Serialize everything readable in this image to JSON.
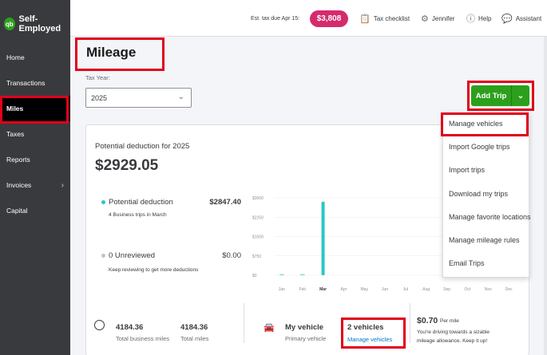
{
  "app": {
    "brand_logo": "qb",
    "brand_name": "Self-Employed"
  },
  "sidebar": {
    "items": [
      {
        "label": "Home"
      },
      {
        "label": "Transactions"
      },
      {
        "label": "Miles"
      },
      {
        "label": "Taxes"
      },
      {
        "label": "Reports"
      },
      {
        "label": "Invoices"
      },
      {
        "label": "Capital"
      }
    ],
    "active": "Miles"
  },
  "topbar": {
    "est_tax_label": "Est. tax due Apr 15:",
    "est_tax_amount": "$3,808",
    "tax_checklist": "Tax checklist",
    "user": "Jennifer",
    "help": "Help",
    "assistant": "Assistant"
  },
  "page": {
    "title": "Mileage",
    "tax_year_label": "Tax Year:",
    "tax_year_value": "2025",
    "add_trip_label": "Add Trip"
  },
  "summary": {
    "potential_deduction_label": "Potential deduction for 2025",
    "potential_deduction_value": "$2929.05",
    "row1_title": "Potential deduction",
    "row1_sub": "4 Business trips in March",
    "row1_amount": "$2847.40",
    "row2_title": "0 Unreviewed",
    "row2_sub": "Keep reviewing to get more deductions",
    "row2_amount": "$0.00"
  },
  "chart_data": {
    "type": "bar",
    "categories": [
      "Jan",
      "Feb",
      "Mar",
      "Apr",
      "May",
      "Jun",
      "Jul",
      "Aug",
      "Sep",
      "Oct",
      "Nov",
      "Dec"
    ],
    "values": [
      40,
      40,
      2847.4,
      0,
      0,
      0,
      0,
      0,
      0,
      0,
      0,
      0
    ],
    "ytick_labels": [
      "$0",
      "$750",
      "$1500",
      "$2250",
      "$3000"
    ],
    "yticks": [
      0,
      750,
      1500,
      2250,
      3000
    ],
    "ylim": [
      0,
      3000
    ],
    "highlight_category": "Mar",
    "bar_color": "#2bc6c6",
    "stub_color": "#8adede"
  },
  "menu": {
    "items": [
      {
        "label": "Manage vehicles"
      },
      {
        "label": "Import Google trips"
      },
      {
        "label": "Import trips"
      },
      {
        "label": "Download my trips"
      },
      {
        "label": "Manage favorite locations"
      },
      {
        "label": "Manage mileage rules"
      },
      {
        "label": "Email Trips"
      }
    ]
  },
  "stats": {
    "business_miles_value": "4184.36",
    "business_miles_label": "Total business miles",
    "total_miles_value": "4184.36",
    "total_miles_label": "Total miles",
    "vehicle_title": "My vehicle",
    "vehicle_sub": "Primary vehicle",
    "vehicles_count": "2 vehicles",
    "manage_vehicles_link": "Manage vehicles",
    "rate_value": "$0.70",
    "rate_unit": "Per mile",
    "rate_note_1": "You're driving towards a sizable",
    "rate_note_2": "mileage allowance. Keep it up!"
  },
  "colors": {
    "accent_green": "#2ca01c",
    "tax_pill": "#d52b6d",
    "highlight_red": "#e0001b",
    "link_blue": "#0077c5",
    "dot_teal": "#2bc6c6"
  }
}
